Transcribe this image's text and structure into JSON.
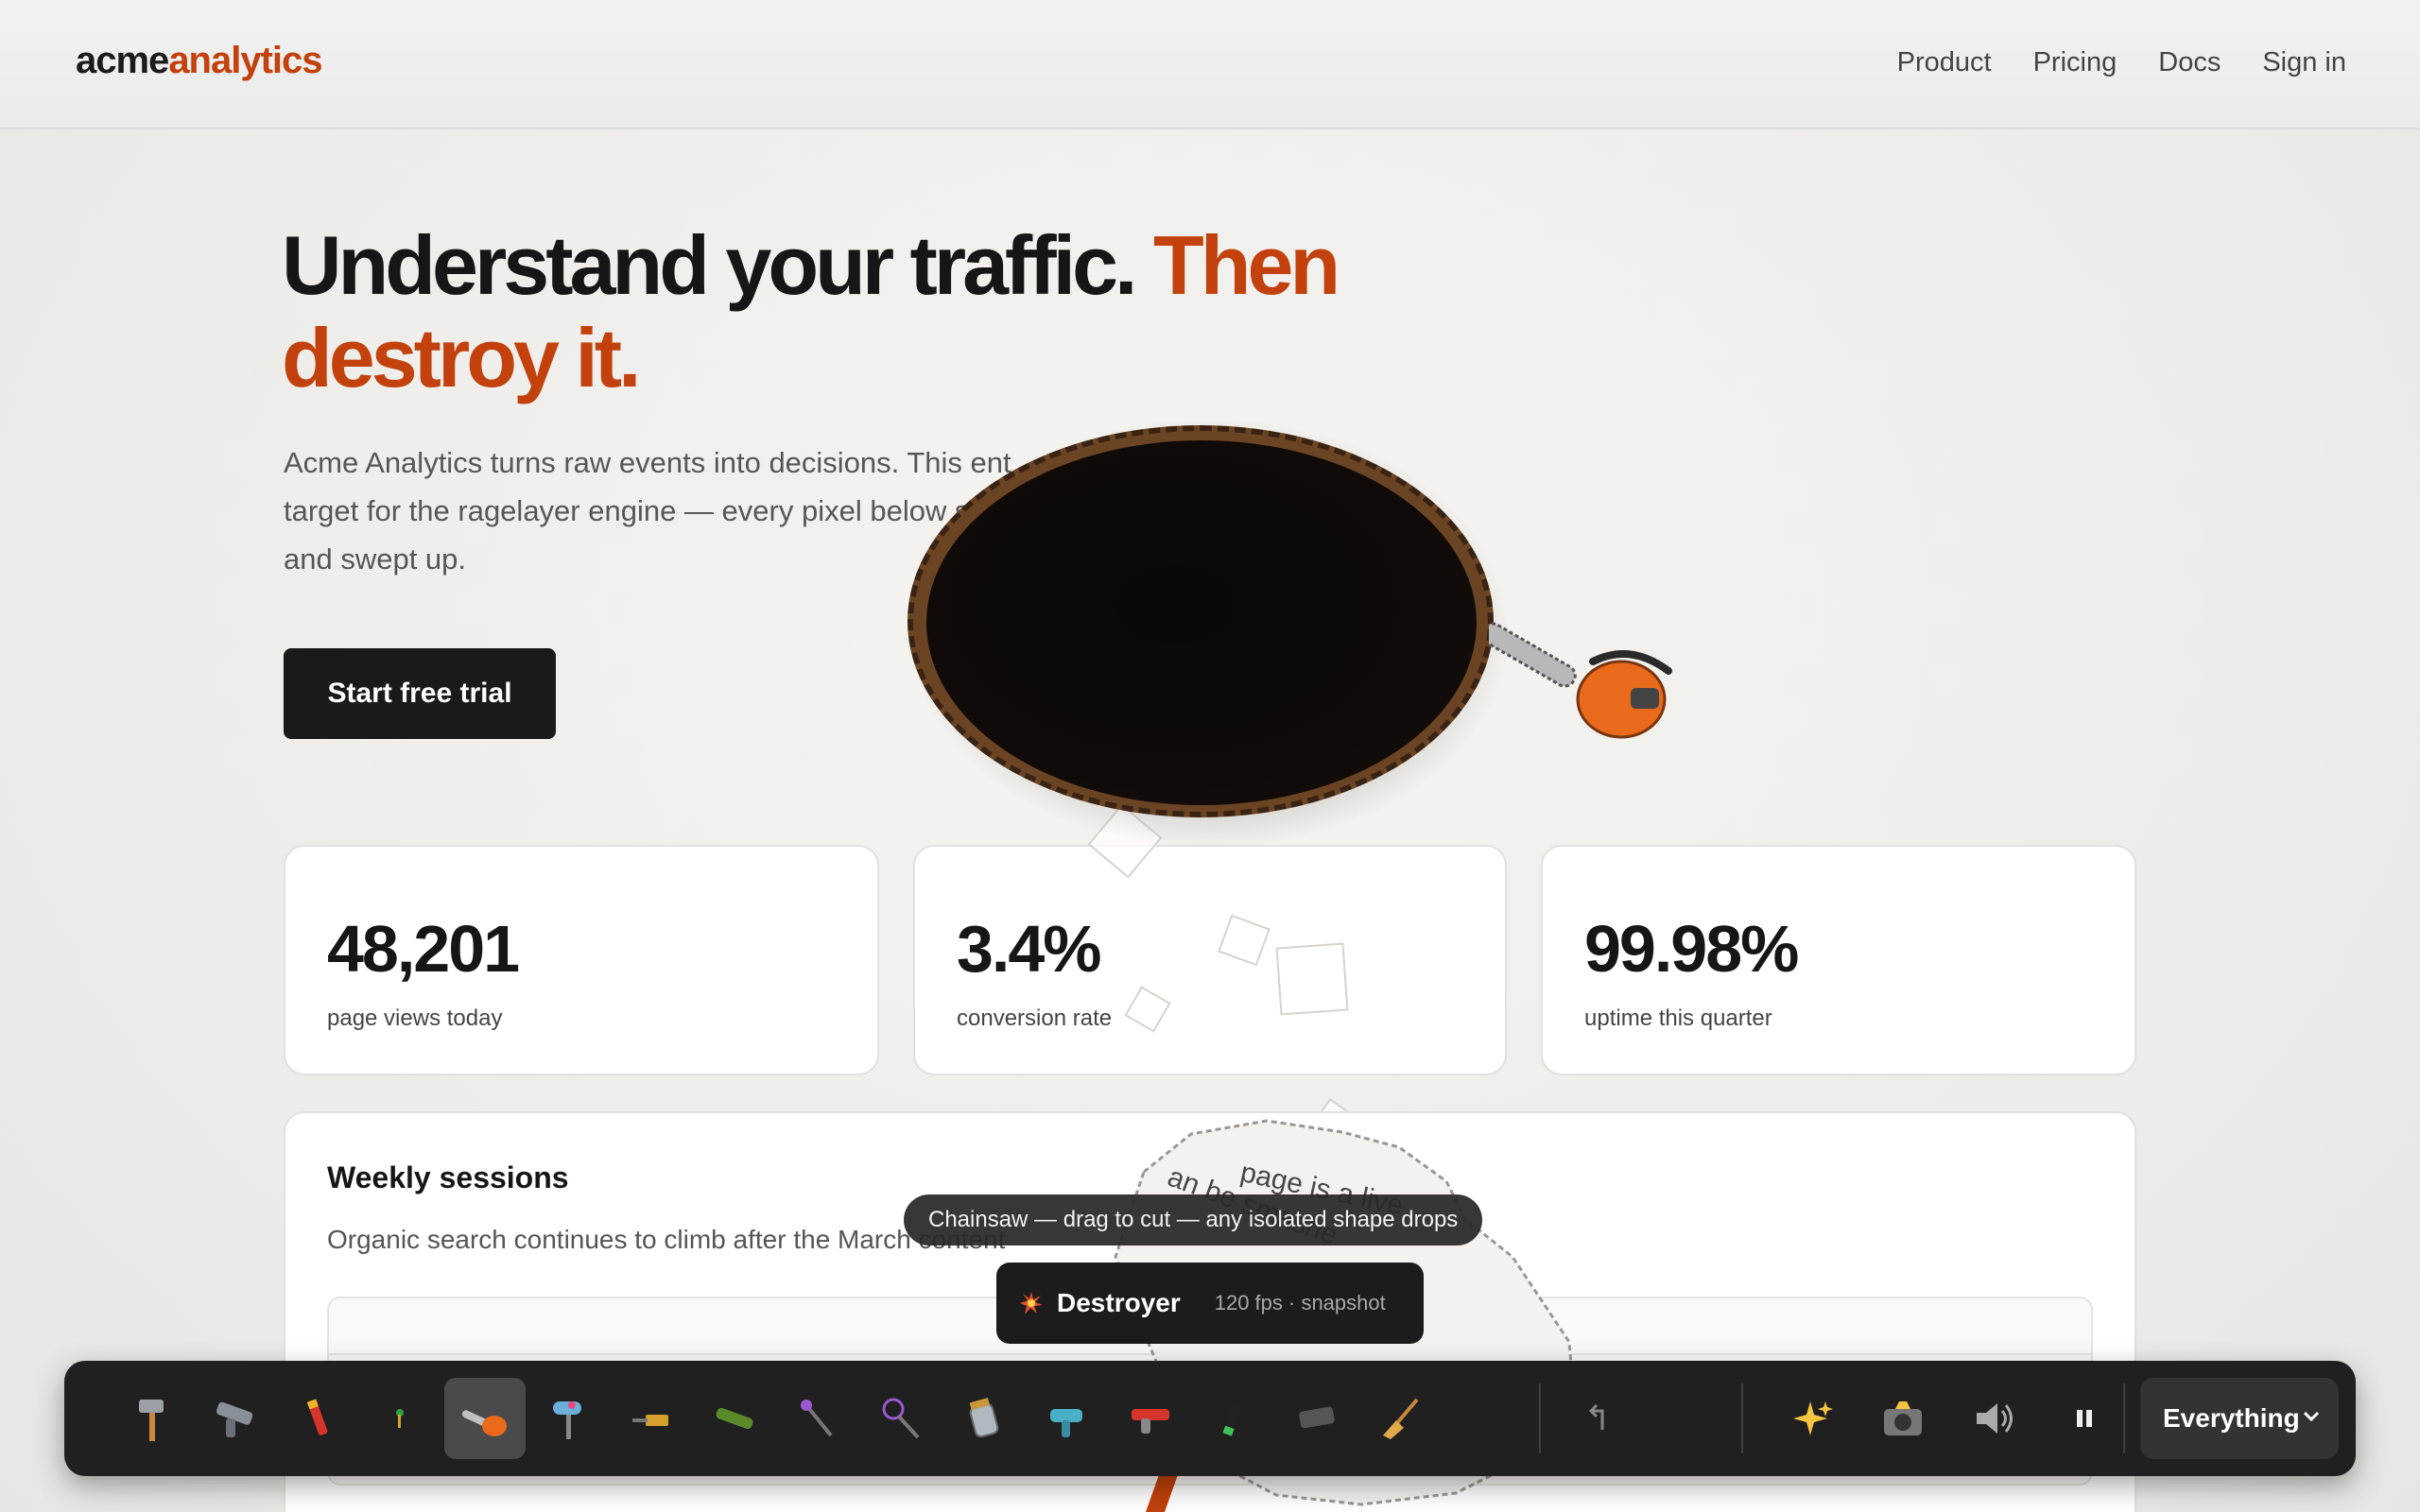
{
  "header": {
    "logo_a": "acme",
    "logo_b": "analytics",
    "nav": [
      "Product",
      "Pricing",
      "Docs",
      "Sign in"
    ]
  },
  "hero": {
    "title_a": "Understand your traffic. ",
    "title_b": "Then destroy it.",
    "desc": "Acme Analytics turns raw events into decisions. This ent target for the ragelayer engine — every pixel below shot and swept up.",
    "cta": "Start free trial"
  },
  "stats": [
    {
      "value": "48,201",
      "label": "page views today"
    },
    {
      "value": "3.4%",
      "label": "conversion rate"
    },
    {
      "value": "99.98%",
      "label": "uptime this quarter"
    }
  ],
  "panel": {
    "title": "Weekly sessions",
    "subtitle": "Organic search continues to climb after the March content"
  },
  "flake_text": [
    "page is a live",
    "an be smashe"
  ],
  "tooltip": "Chainsaw — drag to cut — any isolated shape drops",
  "hud": {
    "title": "Destroyer",
    "stats": "120 fps · snapshot",
    "icon": "explosion-icon"
  },
  "toolbar": {
    "tools": [
      "hammer",
      "gun",
      "crayon",
      "pin",
      "chainsaw",
      "roller",
      "blaster",
      "launcher",
      "wand",
      "lasso",
      "jar",
      "glue-gun",
      "flamethrower",
      "marker",
      "eraser",
      "broom"
    ],
    "active_tool": "chainsaw",
    "actions": [
      "undo",
      "sparkles",
      "camera",
      "sound",
      "pause"
    ],
    "mode": "Everything"
  },
  "colors": {
    "accent": "#c2410c",
    "dark": "#1a1a1a"
  }
}
